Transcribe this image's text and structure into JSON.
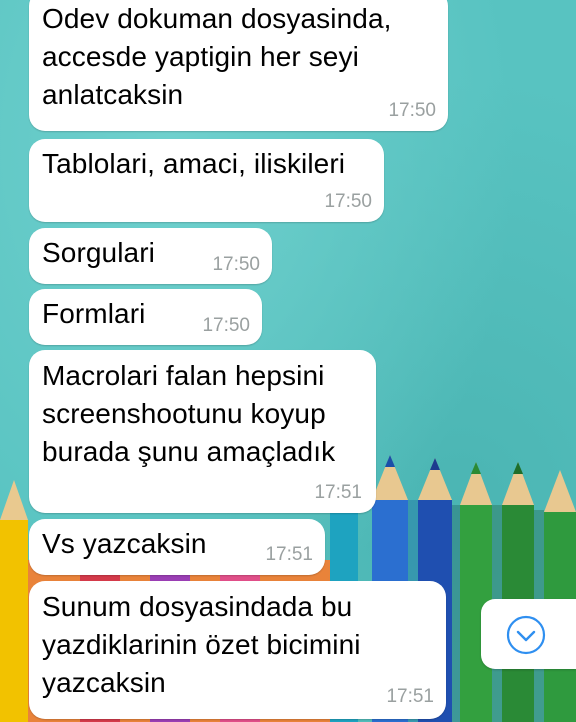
{
  "messages": [
    {
      "text": "Odev dokuman dosyasinda,\naccesde yaptigin her seyi\nanlatcaksin",
      "time": "17:50"
    },
    {
      "text": "Tablolari, amaci, iliskileri",
      "time": "17:50"
    },
    {
      "text": "Sorgulari",
      "time": "17:50"
    },
    {
      "text": "Formlari",
      "time": "17:50"
    },
    {
      "text": "Macrolari falan hepsini\nscreenshootunu koyup\nburada şunu amaçladık",
      "time": "17:51"
    },
    {
      "text": "Vs yazcaksin",
      "time": "17:51"
    },
    {
      "text": "Sunum dosyasindada bu\nyazdiklarinin özet bicimini\nyazcaksin",
      "time": "17:51"
    }
  ],
  "scroll_button": {
    "icon": "chevron-down-icon",
    "color": "#2f8ff0"
  },
  "wallpaper": {
    "description_colors": [
      "#58c3c1",
      "#f2c200",
      "#2d6fcc",
      "#2f9a3e"
    ]
  }
}
